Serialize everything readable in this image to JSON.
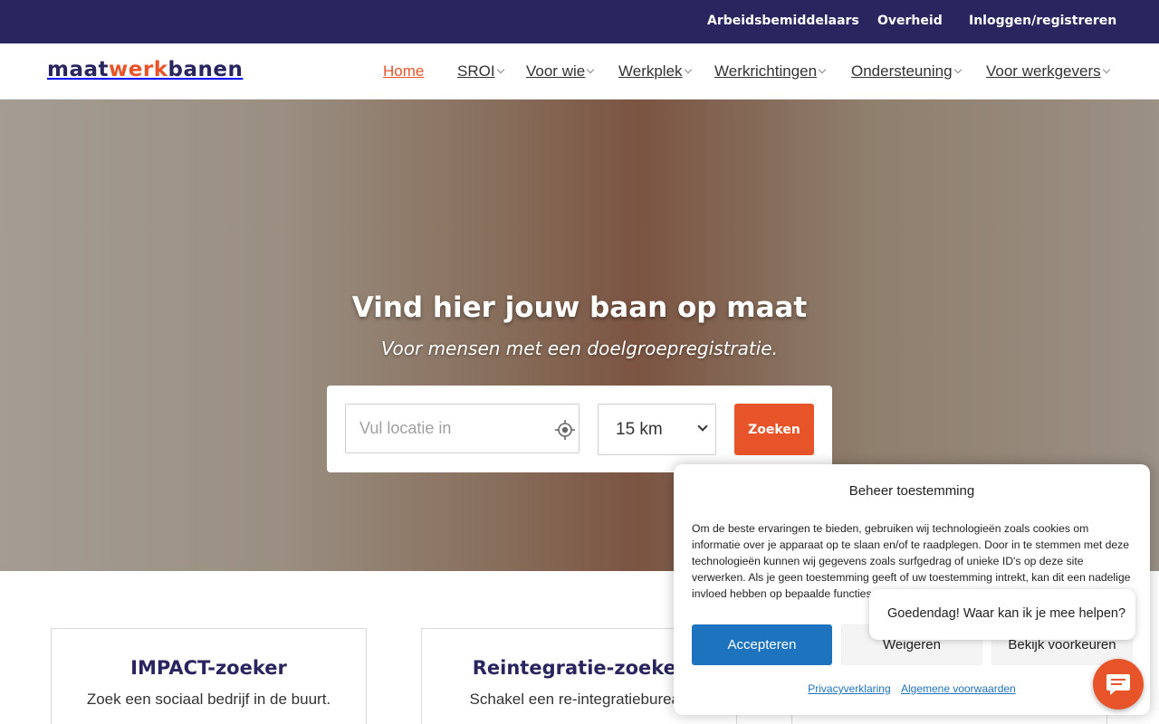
{
  "topbar": {
    "links": [
      "Arbeidsbemiddelaars",
      "Overheid",
      "Inloggen/registreren"
    ]
  },
  "logo": {
    "part1": "maat",
    "part2": "werk",
    "part3": "banen"
  },
  "nav": {
    "items": [
      {
        "label": "Home",
        "active": true,
        "dropdown": false
      },
      {
        "label": "SROI",
        "dropdown": true
      },
      {
        "label": "Voor wie",
        "dropdown": true
      },
      {
        "label": "Werkplek",
        "dropdown": true
      },
      {
        "label": "Werkrichtingen",
        "dropdown": true
      },
      {
        "label": "Ondersteuning",
        "dropdown": true
      },
      {
        "label": "Voor werkgevers",
        "dropdown": true
      }
    ]
  },
  "hero": {
    "title": "Vind hier jouw baan op maat",
    "subtitle": "Voor mensen met een doelgroepregistratie."
  },
  "search": {
    "location_placeholder": "Vul locatie in",
    "location_value": "",
    "radius_selected": "15 km",
    "button_label": "Zoeken"
  },
  "cards": [
    {
      "title": "IMPACT-zoeker",
      "text": "Zoek een sociaal bedrijf in de buurt."
    },
    {
      "title": "Reintegratie-zoeker",
      "text": "Schakel een re-integratiebureau"
    }
  ],
  "consent": {
    "title": "Beheer toestemming",
    "body": "Om de beste ervaringen te bieden, gebruiken wij technologieën zoals cookies om informatie over je apparaat op te slaan en/of te raadplegen. Door in te stemmen met deze technologieën kunnen wij gegevens zoals surfgedrag of unieke ID's op deze site verwerken. Als je geen toestemming geeft of uw toestemming intrekt, kan dit een nadelige invloed hebben op bepaalde functies en mogelijkheden.",
    "accept_label": "Accepteren",
    "deny_label": "Weigeren",
    "prefs_label": "Bekijk voorkeuren",
    "privacy_link": "Privacyverklaring",
    "terms_link": "Algemene voorwaarden"
  },
  "chat": {
    "greeting": "Goedendag! Waar kan ik je mee helpen?",
    "icon": "chat-icon"
  },
  "colors": {
    "brand_navy": "#29255f",
    "brand_orange": "#e8542a",
    "consent_blue": "#1e73be"
  }
}
